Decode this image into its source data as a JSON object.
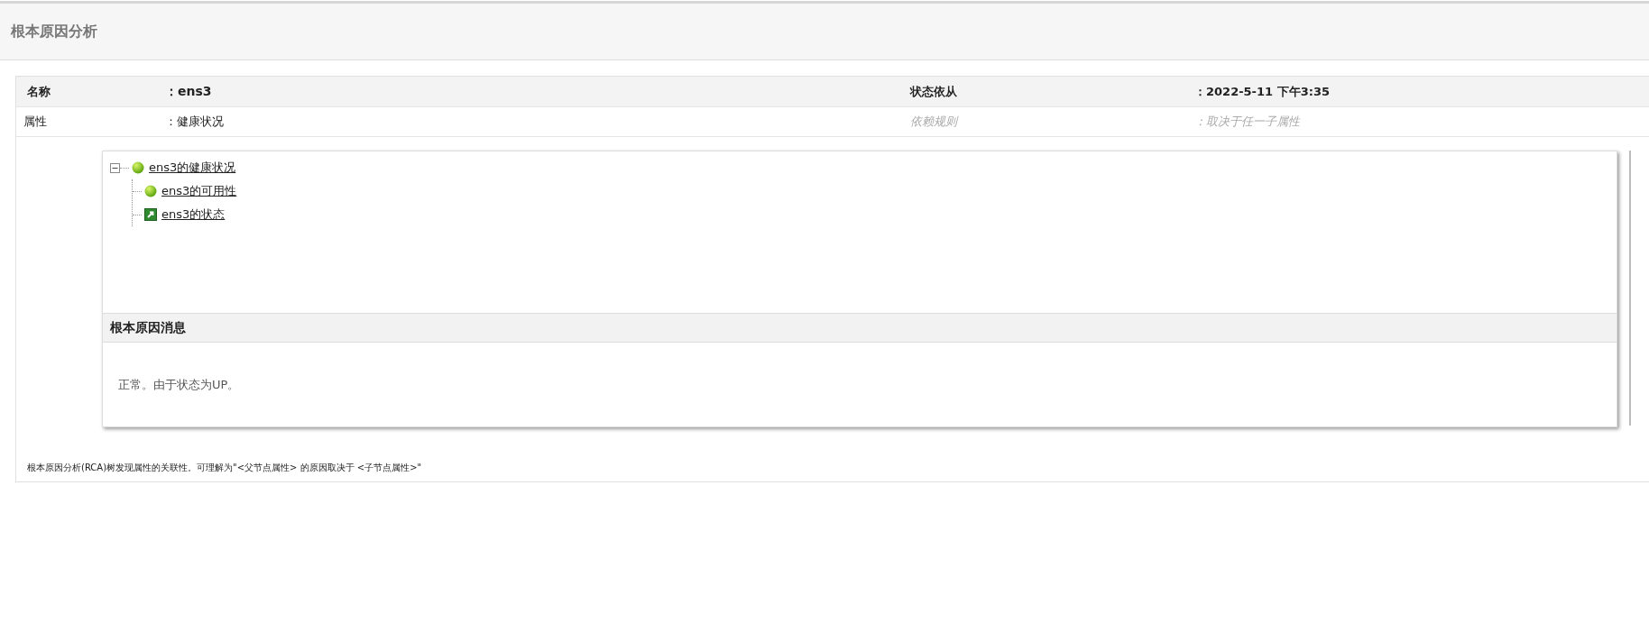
{
  "page_title": "根本原因分析",
  "details": [
    {
      "label": "名称",
      "value": "：ens3",
      "label2": "状态依从",
      "value2": "：2022-5-11 下午3:35",
      "kind": "header"
    },
    {
      "label": "属性",
      "value": "：健康状况",
      "label2": "依赖规则",
      "value2": "：取决于任一子属性",
      "kind": "plain"
    }
  ],
  "tree": [
    {
      "label": "ens3的健康状况",
      "kind": "status",
      "expanded": true,
      "children": [
        {
          "label": "ens3的可用性",
          "kind": "status"
        },
        {
          "label": "ens3的状态",
          "kind": "link"
        }
      ]
    }
  ],
  "message": {
    "title": "根本原因消息",
    "text": "正常。由于状态为UP。"
  },
  "footnote": "根本原因分析(RCA)树发现属性的关联性。可理解为\"<父节点属性> 的原因取决于 <子节点属性>\""
}
